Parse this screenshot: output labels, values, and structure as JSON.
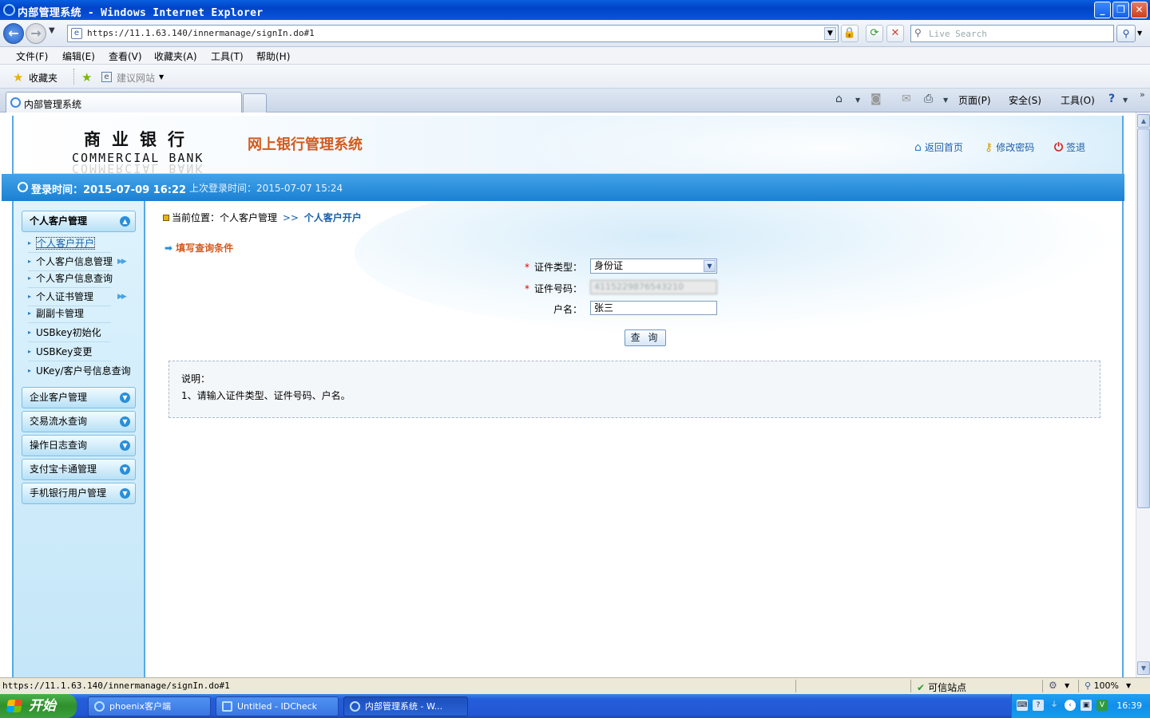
{
  "window": {
    "title": "内部管理系统 - Windows Internet Explorer"
  },
  "browser": {
    "url": "https://11.1.63.140/innermanage/signIn.do#1",
    "search_placeholder": "Live Search",
    "menu": [
      "文件(F)",
      "编辑(E)",
      "查看(V)",
      "收藏夹(A)",
      "工具(T)",
      "帮助(H)"
    ],
    "favorites_label": "收藏夹",
    "suggested_sites": "建议网站",
    "tab_title": "内部管理系统",
    "commands": {
      "page": "页面(P)",
      "safety": "安全(S)",
      "tools": "工具(O)"
    }
  },
  "header": {
    "bank_cn": "商业银行",
    "bank_en": "COMMERCIAL BANK",
    "system_title": "网上银行管理系统",
    "links": {
      "home": "返回首页",
      "change_password": "修改密码",
      "logout": "签退"
    }
  },
  "login": {
    "current": "登录时间：2015-07-09 16:22",
    "last": "上次登录时间：2015-07-07 15:24"
  },
  "sidebar": {
    "open_group": "个人客户管理",
    "items": [
      "个人客户开户",
      "个人客户信息管理",
      "个人客户信息查询",
      "个人证书管理",
      "副副卡管理",
      "USBkey初始化",
      "USBKey变更",
      "UKey/客户号信息查询"
    ],
    "groups": [
      "企业客户管理",
      "交易流水查询",
      "操作日志查询",
      "支付宝卡通管理",
      "手机银行用户管理"
    ]
  },
  "content": {
    "breadcrumb_prefix": "当前位置：个人客户管理",
    "breadcrumb_sep": ">>",
    "breadcrumb_current": "个人客户开户",
    "section_title": "填写查询条件",
    "form": {
      "id_type_label": "证件类型：",
      "id_type_value": "身份证",
      "id_number_label": "证件号码：",
      "id_number_value": "4115229876543210",
      "name_label": "户名：",
      "name_value": "张三",
      "query_button": "查 询"
    },
    "notes": {
      "title": "说明：",
      "line1": "1、请输入证件类型、证件号码、户名。"
    }
  },
  "status": {
    "url": "https://11.1.63.140/innermanage/signIn.do#1",
    "zone": "可信站点",
    "zoom": "100%"
  },
  "taskbar": {
    "start": "开始",
    "tasks": [
      "phoenix客户端",
      "Untitled - IDCheck",
      "内部管理系统 - W..."
    ],
    "time": "16:39"
  }
}
